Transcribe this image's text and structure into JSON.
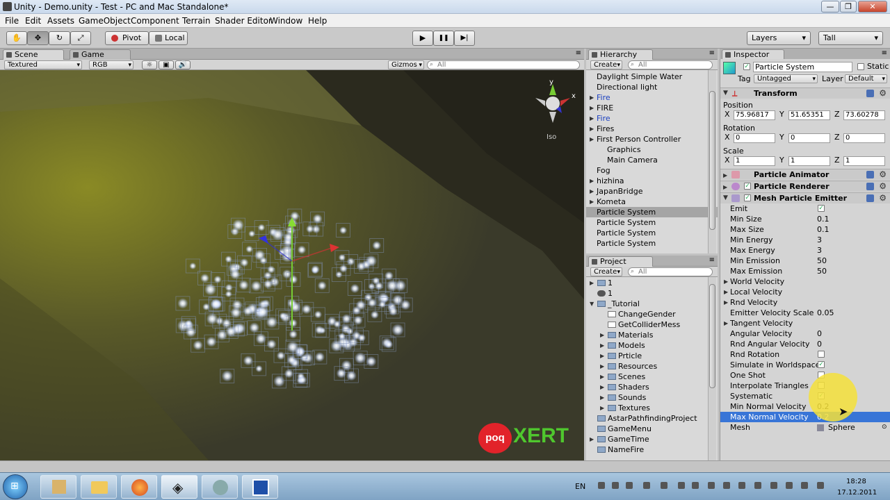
{
  "window": {
    "title": "Unity - Demo.unity - Test - PC and Mac Standalone*",
    "minimize": "—",
    "maximize": "❐",
    "close": "✕"
  },
  "menu": [
    "File",
    "Edit",
    "Assets",
    "GameObject",
    "Component",
    "Terrain",
    "Shader Editor",
    "Window",
    "Help"
  ],
  "toolbar": {
    "pivot": "Pivot",
    "local": "Local",
    "play": "▶",
    "pause": "❚❚",
    "step": "▶|",
    "layers": "Layers",
    "layout": "Tall"
  },
  "scene": {
    "tab_scene": "Scene",
    "tab_game": "Game",
    "render_mode": "Textured",
    "color_mode": "RGB",
    "gizmos": "Gizmos",
    "search_placeholder": "All",
    "gizmo_label": "Iso",
    "gizmo_x": "x",
    "gizmo_y": "y",
    "watermark_badge": "poq",
    "watermark_text": "XERT"
  },
  "hierarchy": {
    "title": "Hierarchy",
    "create": "Create",
    "search_placeholder": "All",
    "items": [
      {
        "label": "Daylight Simple Water",
        "indent": 0,
        "arrow": false,
        "blue": false,
        "selected": false
      },
      {
        "label": "Directional light",
        "indent": 0,
        "arrow": false,
        "blue": false,
        "selected": false
      },
      {
        "label": "Fire",
        "indent": 0,
        "arrow": true,
        "blue": true,
        "selected": false
      },
      {
        "label": "FIRE",
        "indent": 0,
        "arrow": true,
        "blue": false,
        "selected": false
      },
      {
        "label": "Fire",
        "indent": 0,
        "arrow": true,
        "blue": true,
        "selected": false
      },
      {
        "label": "Fires",
        "indent": 0,
        "arrow": true,
        "blue": false,
        "selected": false
      },
      {
        "label": "First Person Controller",
        "indent": 0,
        "arrow": true,
        "blue": false,
        "selected": false
      },
      {
        "label": "Graphics",
        "indent": 1,
        "arrow": false,
        "blue": false,
        "selected": false
      },
      {
        "label": "Main Camera",
        "indent": 1,
        "arrow": false,
        "blue": false,
        "selected": false
      },
      {
        "label": "Fog",
        "indent": 0,
        "arrow": false,
        "blue": false,
        "selected": false
      },
      {
        "label": "hizhina",
        "indent": 0,
        "arrow": true,
        "blue": false,
        "selected": false
      },
      {
        "label": "JapanBridge",
        "indent": 0,
        "arrow": true,
        "blue": false,
        "selected": false
      },
      {
        "label": "Kometa",
        "indent": 0,
        "arrow": true,
        "blue": false,
        "selected": false
      },
      {
        "label": "Particle System",
        "indent": 0,
        "arrow": false,
        "blue": false,
        "selected": true
      },
      {
        "label": "Particle System",
        "indent": 0,
        "arrow": false,
        "blue": false,
        "selected": false
      },
      {
        "label": "Particle System",
        "indent": 0,
        "arrow": false,
        "blue": false,
        "selected": false
      },
      {
        "label": "Particle System",
        "indent": 0,
        "arrow": false,
        "blue": false,
        "selected": false
      }
    ]
  },
  "project": {
    "title": "Project",
    "create": "Create",
    "search_placeholder": "All",
    "items": [
      {
        "label": "1",
        "indent": 0,
        "arrow": true,
        "kind": "folder"
      },
      {
        "label": "1",
        "indent": 0,
        "arrow": false,
        "kind": "scene"
      },
      {
        "label": "_Tutorial",
        "indent": 0,
        "arrow": true,
        "kind": "folder"
      },
      {
        "label": "ChangeGender",
        "indent": 1,
        "arrow": false,
        "kind": "script"
      },
      {
        "label": "GetColliderMess",
        "indent": 1,
        "arrow": false,
        "kind": "script"
      },
      {
        "label": "Materials",
        "indent": 1,
        "arrow": true,
        "kind": "folder"
      },
      {
        "label": "Models",
        "indent": 1,
        "arrow": true,
        "kind": "folder"
      },
      {
        "label": "Prticle",
        "indent": 1,
        "arrow": true,
        "kind": "folder"
      },
      {
        "label": "Resources",
        "indent": 1,
        "arrow": true,
        "kind": "folder"
      },
      {
        "label": "Scenes",
        "indent": 1,
        "arrow": true,
        "kind": "folder"
      },
      {
        "label": "Shaders",
        "indent": 1,
        "arrow": true,
        "kind": "folder"
      },
      {
        "label": "Sounds",
        "indent": 1,
        "arrow": true,
        "kind": "folder"
      },
      {
        "label": "Textures",
        "indent": 1,
        "arrow": true,
        "kind": "folder"
      },
      {
        "label": "AstarPathfindingProject",
        "indent": 0,
        "arrow": false,
        "kind": "folder"
      },
      {
        "label": "GameMenu",
        "indent": 0,
        "arrow": false,
        "kind": "folder"
      },
      {
        "label": "GameTime",
        "indent": 0,
        "arrow": true,
        "kind": "folder"
      },
      {
        "label": "NameFire",
        "indent": 0,
        "arrow": false,
        "kind": "folder"
      }
    ]
  },
  "inspector": {
    "title": "Inspector",
    "object_name": "Particle System",
    "static_label": "Static",
    "tag_label": "Tag",
    "tag_value": "Untagged",
    "layer_label": "Layer",
    "layer_value": "Default",
    "transform": {
      "title": "Transform",
      "position_label": "Position",
      "position": [
        "75.96817",
        "51.65351",
        "73.60278"
      ],
      "rotation_label": "Rotation",
      "rotation": [
        "0",
        "0",
        "0"
      ],
      "scale_label": "Scale",
      "scale": [
        "1",
        "1",
        "1"
      ],
      "axes": [
        "X",
        "Y",
        "Z"
      ]
    },
    "components": [
      "Particle Animator",
      "Particle Renderer",
      "Mesh Particle Emitter"
    ],
    "emitter_props": [
      {
        "label": "Emit",
        "type": "check",
        "value": true,
        "fold": false,
        "highlight": false
      },
      {
        "label": "Min Size",
        "type": "text",
        "value": "0.1",
        "fold": false,
        "highlight": false
      },
      {
        "label": "Max Size",
        "type": "text",
        "value": "0.1",
        "fold": false,
        "highlight": false
      },
      {
        "label": "Min Energy",
        "type": "text",
        "value": "3",
        "fold": false,
        "highlight": false
      },
      {
        "label": "Max Energy",
        "type": "text",
        "value": "3",
        "fold": false,
        "highlight": false
      },
      {
        "label": "Min Emission",
        "type": "text",
        "value": "50",
        "fold": false,
        "highlight": false
      },
      {
        "label": "Max Emission",
        "type": "text",
        "value": "50",
        "fold": false,
        "highlight": false
      },
      {
        "label": "World Velocity",
        "type": "none",
        "value": "",
        "fold": true,
        "highlight": false
      },
      {
        "label": "Local Velocity",
        "type": "none",
        "value": "",
        "fold": true,
        "highlight": false
      },
      {
        "label": "Rnd Velocity",
        "type": "none",
        "value": "",
        "fold": true,
        "highlight": false
      },
      {
        "label": "Emitter Velocity Scale",
        "type": "text",
        "value": "0.05",
        "fold": false,
        "highlight": false
      },
      {
        "label": "Tangent Velocity",
        "type": "none",
        "value": "",
        "fold": true,
        "highlight": false
      },
      {
        "label": "Angular Velocity",
        "type": "text",
        "value": "0",
        "fold": false,
        "highlight": false
      },
      {
        "label": "Rnd Angular Velocity",
        "type": "text",
        "value": "0",
        "fold": false,
        "highlight": false
      },
      {
        "label": "Rnd Rotation",
        "type": "check",
        "value": false,
        "fold": false,
        "highlight": false
      },
      {
        "label": "Simulate in Worldspace",
        "type": "check",
        "value": true,
        "fold": false,
        "highlight": false
      },
      {
        "label": "One Shot",
        "type": "check",
        "value": false,
        "fold": false,
        "highlight": false
      },
      {
        "label": "Interpolate Triangles",
        "type": "check",
        "value": false,
        "fold": false,
        "highlight": false
      },
      {
        "label": "Systematic",
        "type": "check",
        "value": true,
        "fold": false,
        "highlight": false
      },
      {
        "label": "Min Normal Velocity",
        "type": "text",
        "value": "0.2",
        "fold": false,
        "highlight": false
      },
      {
        "label": "Max Normal Velocity",
        "type": "text",
        "value": "0.2",
        "fold": false,
        "highlight": true
      },
      {
        "label": "Mesh",
        "type": "object",
        "value": "Sphere",
        "fold": false,
        "highlight": false
      }
    ]
  },
  "taskbar": {
    "lang": "EN",
    "time": "18:28",
    "date": "17.12.2011"
  },
  "colors": {
    "selection_blue": "#3875d7",
    "hierarchy_blue": "#1a3fc0",
    "highlight_yellow": "#f5e13a"
  }
}
